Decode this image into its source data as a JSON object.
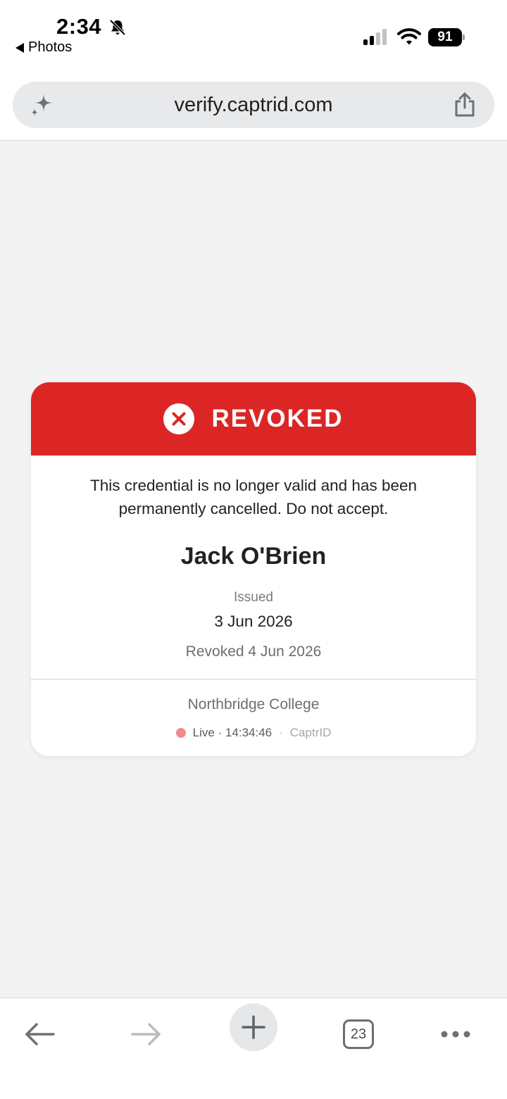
{
  "status_bar": {
    "time": "2:34",
    "back_app": "Photos",
    "battery": "91",
    "icons": [
      "bell-slash-icon",
      "signal-icon",
      "wifi-icon",
      "battery-icon"
    ]
  },
  "browser": {
    "url": "verify.captrid.com",
    "icons": [
      "sparkle-icon",
      "share-icon"
    ]
  },
  "credential": {
    "status": "REVOKED",
    "status_color": "#dc2626",
    "message": "This credential is no longer valid and has been permanently cancelled. Do not accept.",
    "holder_name": "Jack O'Brien",
    "issued_label": "Issued",
    "issued_date": "3 Jun 2026",
    "revoked_text": "Revoked 4 Jun 2026",
    "issuer": "Northbridge College",
    "live_label": "Live · 14:34:46",
    "separator": "·",
    "brand": "CaptrID"
  },
  "bottom_nav": {
    "tabs_count": "23",
    "icons": [
      "back-arrow-icon",
      "forward-arrow-icon",
      "plus-icon",
      "tabs-icon",
      "more-icon"
    ]
  }
}
